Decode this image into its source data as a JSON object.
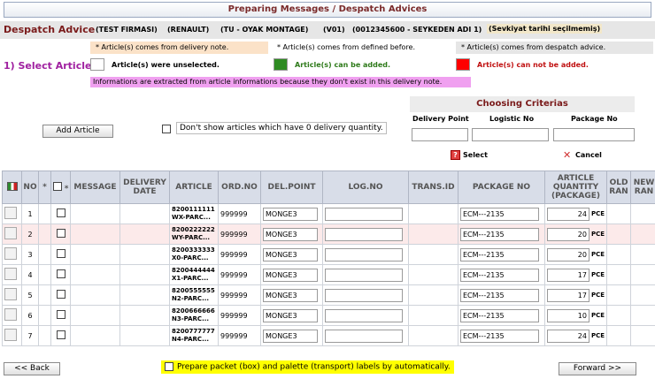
{
  "window": {
    "title": "Preparing Messages / Despatch Advices"
  },
  "header": {
    "label": "Despatch Advice",
    "company": "(TEST FIRMASI)",
    "customer": "(RENAULT)",
    "plant": "(TU - OYAK MONTAGE)",
    "version": "(V01)",
    "consignee": "(0012345600 - SEYKEDEN ADI 1)",
    "warning": "(Sevkiyat tarihi seçilmemiş)"
  },
  "legend": {
    "delivery_note": "* Article(s) comes from delivery note.",
    "defined_before": "* Article(s) comes from defined before.",
    "despatch_advice": "* Article(s) comes from despatch advice.",
    "unselected": "Article(s) were unselected.",
    "can_be_added": "Article(s) can be added.",
    "cannot_be_added": "Article(s) can not be added.",
    "info": "Informations are extracted from article informations because they don't exist in this delivery note.",
    "colors": {
      "unselected": "#ffffff",
      "can_be_added": "#2e8b22",
      "cannot_be_added": "#ff0000",
      "info": "#f0a0f0"
    }
  },
  "select_article": {
    "title": "1) Select Article"
  },
  "actions": {
    "add_article": "Add Article",
    "zero_label": "Don't show articles which have 0 delivery quantity.",
    "back": "<< Back",
    "forward": "Forward >>",
    "auto_labels": "Prepare packet (box) and palette (transport) labels by automatically."
  },
  "criteria": {
    "title": "Choosing Criterias",
    "delivery_point": "Delivery Point",
    "logistic_no": "Logistic No",
    "package_no": "Package No",
    "select": "Select",
    "cancel": "Cancel"
  },
  "table": {
    "headers": {
      "no": "NO",
      "star1": "*",
      "star2": "*",
      "message": "MESSAGE",
      "delivery_date": "DELIVERY DATE",
      "article": "ARTICLE",
      "ord_no": "ORD.NO",
      "del_point": "DEL.POINT",
      "log_no": "LOG.NO",
      "trans_id": "TRANS.ID",
      "package_no": "PACKAGE NO",
      "article_qty": "ARTICLE QUANTITY (PACKAGE)",
      "old_ran": "OLD RAN",
      "new_ran": "NEW RAN"
    },
    "rows": [
      {
        "no": "1",
        "article_code": "8200111111",
        "article_name": "WX-PARC...",
        "ord_no": "999999",
        "del_point": "MONGE3",
        "package_no": "ECM---2135",
        "qty": "24",
        "unit": "PCE"
      },
      {
        "no": "2",
        "article_code": "8200222222",
        "article_name": "WY-PARC...",
        "ord_no": "999999",
        "del_point": "MONGE3",
        "package_no": "ECM---2135",
        "qty": "20",
        "unit": "PCE"
      },
      {
        "no": "3",
        "article_code": "8200333333",
        "article_name": "X0-PARC...",
        "ord_no": "999999",
        "del_point": "MONGE3",
        "package_no": "ECM---2135",
        "qty": "20",
        "unit": "PCE"
      },
      {
        "no": "4",
        "article_code": "8200444444",
        "article_name": "X1-PARC...",
        "ord_no": "999999",
        "del_point": "MONGE3",
        "package_no": "ECM---2135",
        "qty": "17",
        "unit": "PCE"
      },
      {
        "no": "5",
        "article_code": "8200555555",
        "article_name": "N2-PARC...",
        "ord_no": "999999",
        "del_point": "MONGE3",
        "package_no": "ECM---2135",
        "qty": "17",
        "unit": "PCE"
      },
      {
        "no": "6",
        "article_code": "8200666666",
        "article_name": "N3-PARC...",
        "ord_no": "999999",
        "del_point": "MONGE3",
        "package_no": "ECM---2135",
        "qty": "10",
        "unit": "PCE"
      },
      {
        "no": "7",
        "article_code": "8200777777",
        "article_name": "N4-PARC...",
        "ord_no": "999999",
        "del_point": "MONGE3",
        "package_no": "ECM---2135",
        "qty": "24",
        "unit": "PCE"
      }
    ]
  }
}
